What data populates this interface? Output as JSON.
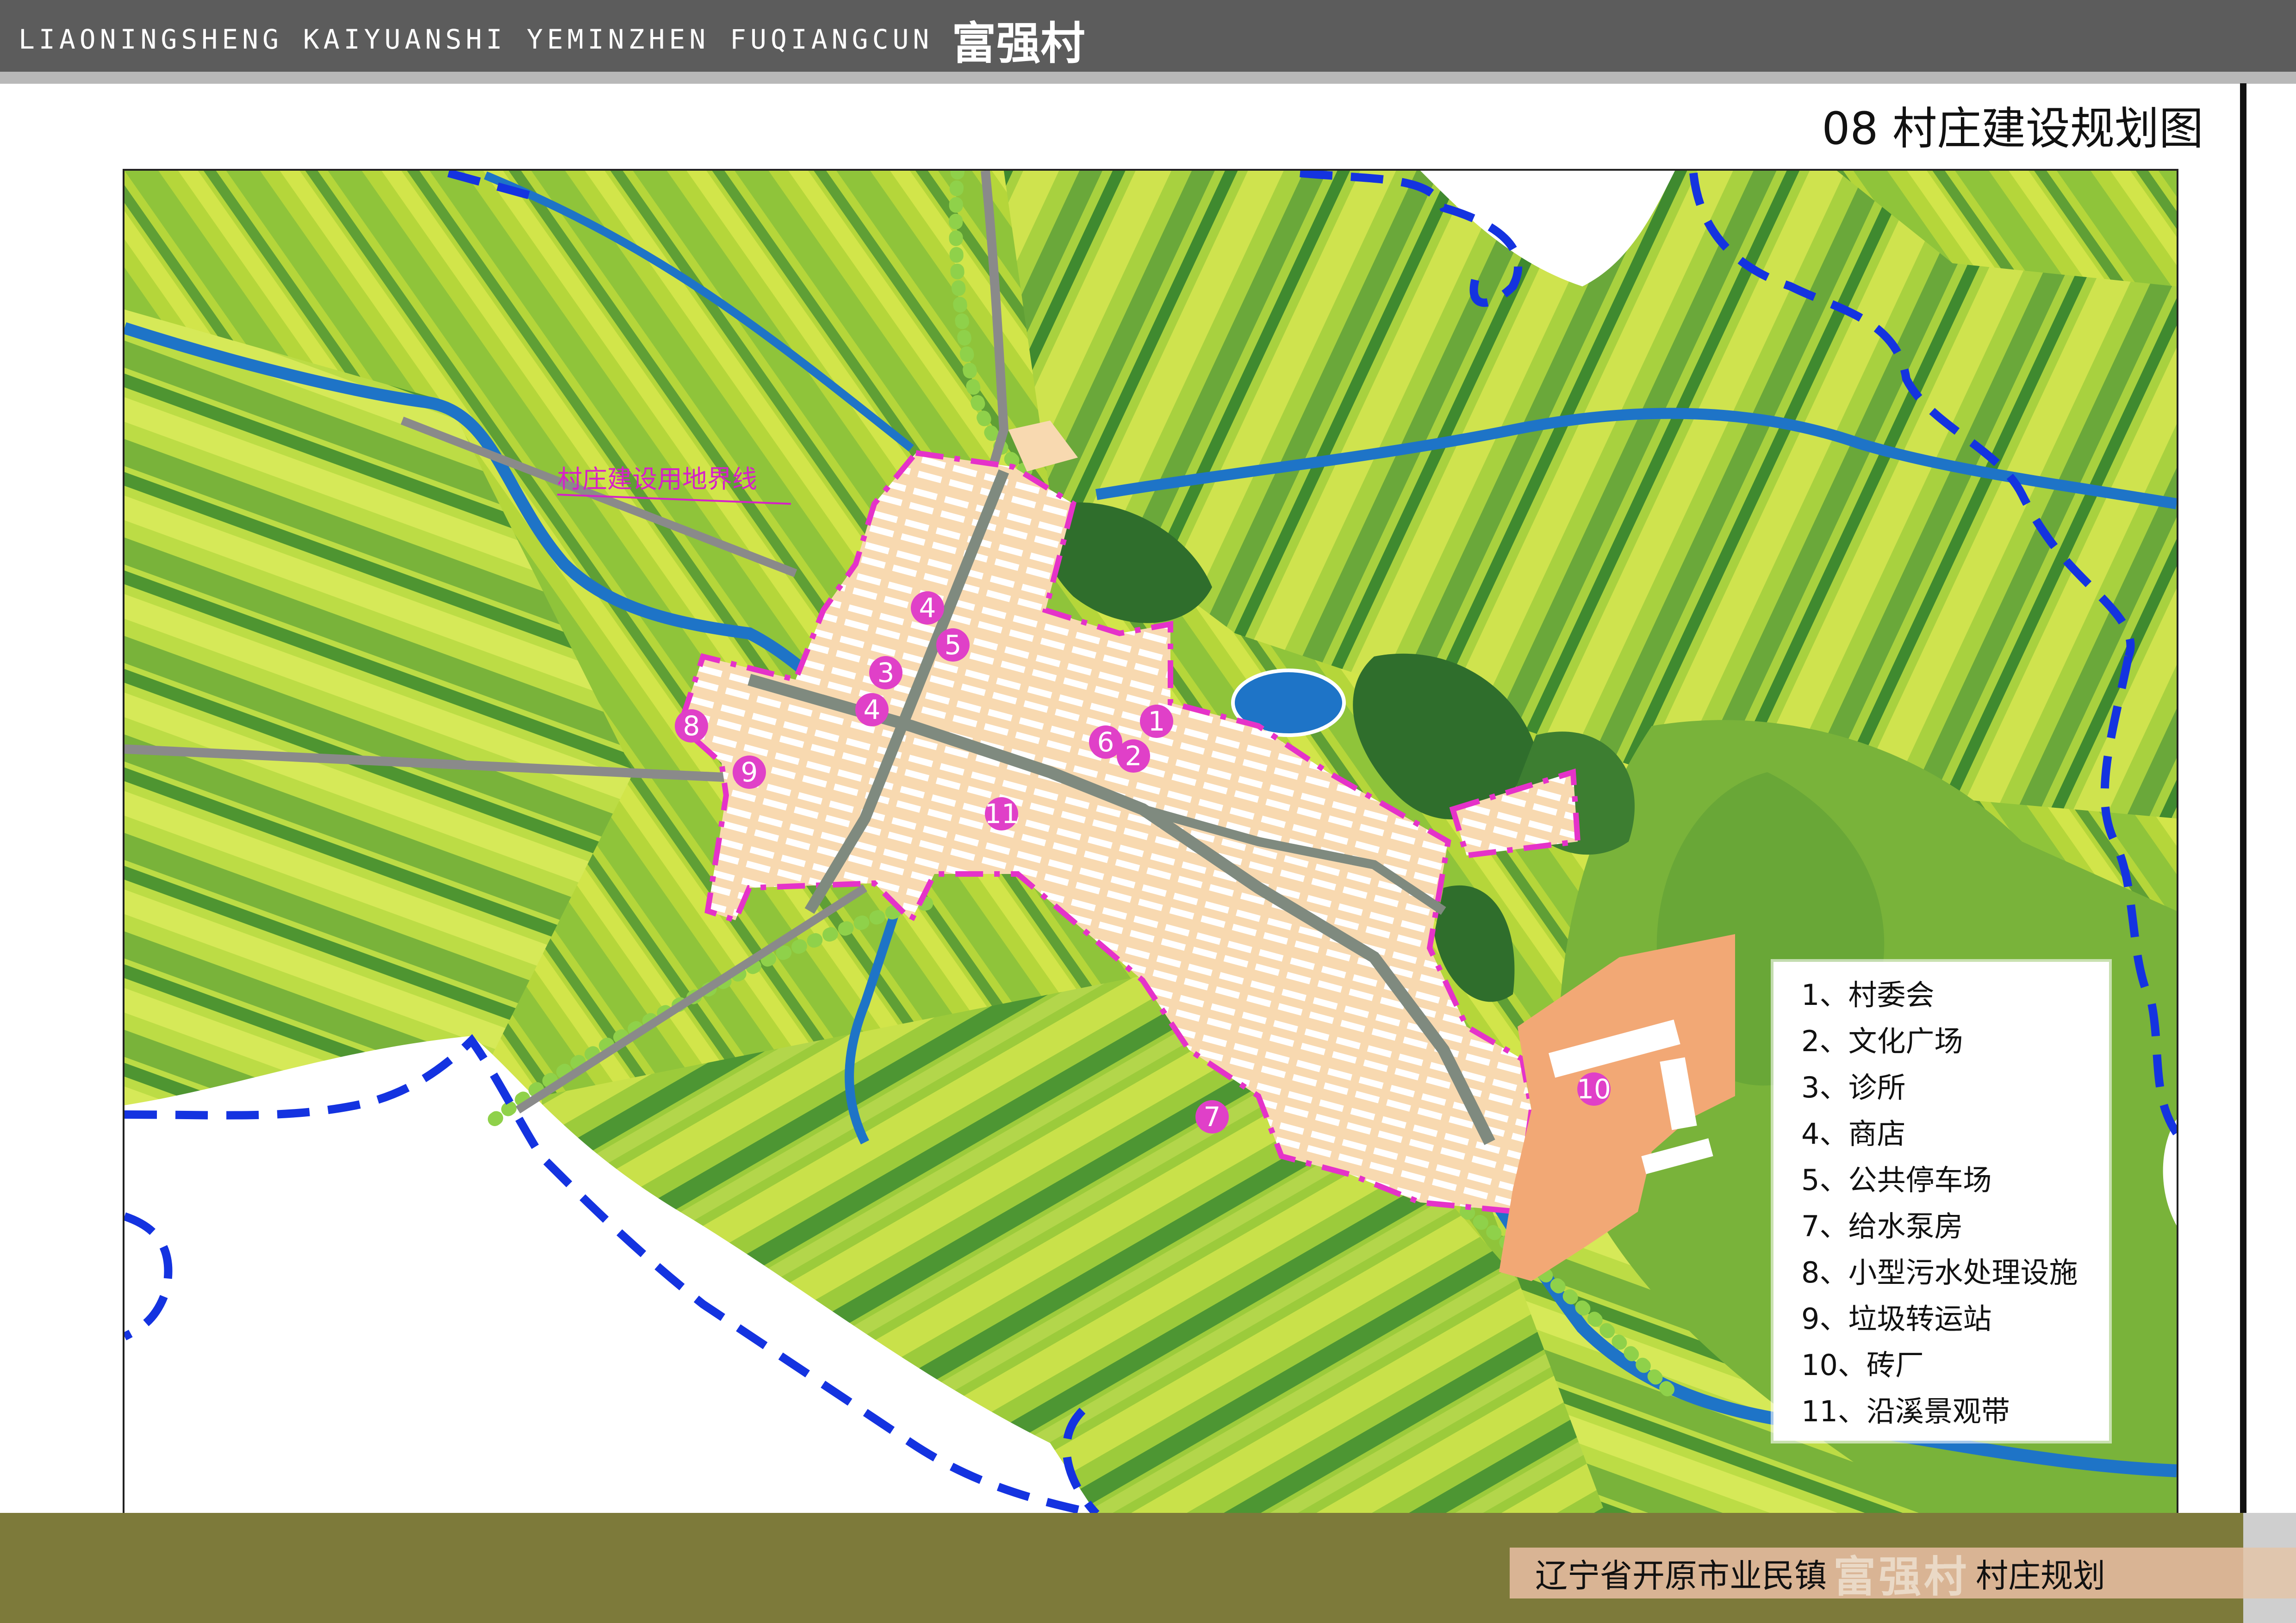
{
  "header": {
    "latin_title": "LIAONINGSHENG KAIYUANSHI YEMINZHEN FUQIANGCUN",
    "chinese_title": "富强村"
  },
  "drawing_title": "08 村庄建设规划图",
  "map": {
    "boundary_label": "村庄建设用地界线",
    "colors": {
      "field_light": "#c8df3c",
      "field_mid": "#99cc33",
      "field_green": "#6aa83a",
      "field_dark": "#3f8a2f",
      "river": "#1e74c7",
      "village_area": "#f8d9b0",
      "road": "#8a8a8a",
      "boundary": "#e532c9",
      "admin_boundary": "#1433e0",
      "brickyard": "#f2a875",
      "forest": "#2f6e2c",
      "poi_marker": "#e040c8"
    },
    "markers": [
      {
        "label": "1"
      },
      {
        "label": "2"
      },
      {
        "label": "3"
      },
      {
        "label": "4"
      },
      {
        "label": "4"
      },
      {
        "label": "5"
      },
      {
        "label": "6"
      },
      {
        "label": "7"
      },
      {
        "label": "8"
      },
      {
        "label": "9"
      },
      {
        "label": "10"
      },
      {
        "label": "11"
      }
    ]
  },
  "legend": {
    "items": [
      "1、村委会",
      "2、文化广场",
      "3、诊所",
      "4、商店",
      "5、公共停车场",
      "7、给水泵房",
      "8、小型污水处理设施",
      "9、垃圾转运站",
      "10、砖厂",
      "11、沿溪景观带"
    ]
  },
  "footer": {
    "prefix": "辽宁省开原市业民镇",
    "village": "富强村",
    "suffix": "村庄规划"
  }
}
